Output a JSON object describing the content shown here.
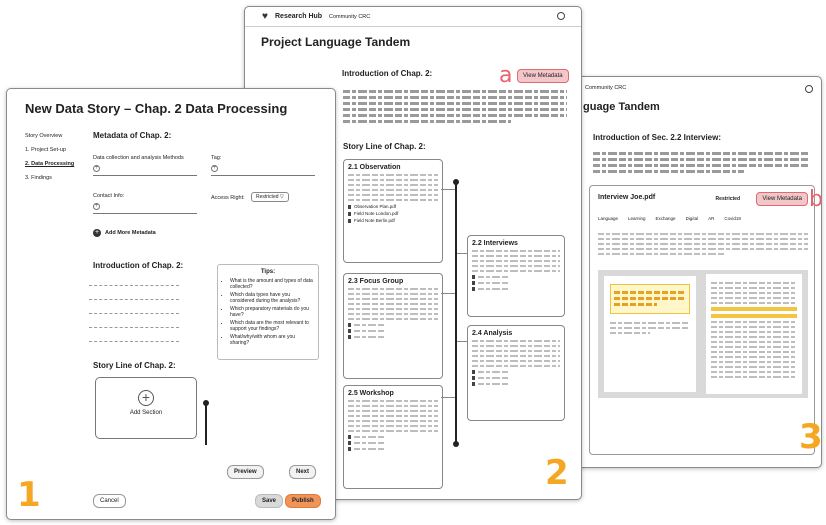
{
  "panel1": {
    "title": "New Data Story  –  Chap. 2  Data Processing",
    "nav": [
      {
        "label": "Story Overview"
      },
      {
        "label": "1. Project Set-up"
      },
      {
        "label": "2. Data Processing"
      },
      {
        "label": "3. Findings"
      }
    ],
    "metadata_heading": "Metadata of Chap. 2:",
    "fields": {
      "methods_label": "Data collection and analysis Methods",
      "tag_label": "Tag:",
      "contact_label": "Contact Info:",
      "access_label": "Access Right:",
      "access_value": "Restricted"
    },
    "add_metadata": "Add More Metadata",
    "intro_heading": "Introduction of Chap. 2:",
    "tips": {
      "title": "Tips:",
      "items": [
        "What is the amount and types of data collected?",
        "Which data types have you considered during the analysis?",
        "Which preparatory materials do you have?",
        "Which data are the most relevant to support your findings?",
        "What/why/with whom are you sharing?"
      ]
    },
    "storyline_heading": "Story Line of Chap. 2:",
    "add_section": "Add Section",
    "buttons": {
      "preview": "Preview",
      "next": "Next",
      "cancel": "Cancel",
      "save": "Save",
      "publish": "Publish"
    },
    "number": "1"
  },
  "panel2": {
    "logo": "Research Hub",
    "community": "Community CRC",
    "title": "Project Language Tandem",
    "intro_heading": "Introduction of Chap. 2:",
    "view_metadata": "View Metadata",
    "marker": "a",
    "storyline_heading": "Story Line of Chap. 2:",
    "sections": [
      {
        "title": "2.1 Observation",
        "files": [
          "Observation Plan.pdf",
          "Field Note London.pdf",
          "Field Note Berlin.pdf"
        ]
      },
      {
        "title": "2.2 Interviews",
        "files": [
          "",
          "",
          ""
        ]
      },
      {
        "title": "2.3 Focus Group",
        "files": [
          "",
          "",
          ""
        ]
      },
      {
        "title": "2.4 Analysis",
        "files": [
          "",
          "",
          ""
        ]
      },
      {
        "title": "2.5 Workshop",
        "files": [
          "",
          "",
          ""
        ]
      }
    ],
    "number": "2"
  },
  "panel3": {
    "community": "Community CRC",
    "title": "guage Tandem",
    "intro_heading": "Introduction of Sec. 2.2 Interview:",
    "doc_name": "Interview Joe.pdf",
    "restricted": "Restricted",
    "view_metadata": "View Metadata",
    "marker": "b",
    "tabs": [
      "Language",
      "Learning",
      "Exchange",
      "Digital",
      "AR",
      "Covid19"
    ],
    "number": "3"
  },
  "colors": {
    "accent_orange": "#f5a623",
    "highlight_red": "#e06a73",
    "publish": "#f0955a"
  }
}
